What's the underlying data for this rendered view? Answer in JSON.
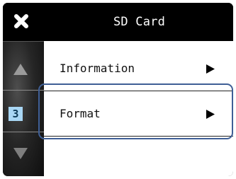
{
  "header": {
    "title": "SD Card",
    "close_icon": "close-icon"
  },
  "side_panel": {
    "page_number": "3",
    "up_icon": "up-arrow-icon",
    "down_icon": "down-arrow-icon"
  },
  "menu": {
    "items": [
      {
        "label": "Information",
        "icon": "right-arrow-icon"
      },
      {
        "label": "Format",
        "icon": "right-arrow-icon",
        "selected": true
      }
    ]
  },
  "colors": {
    "background": "#000000",
    "menu_bg": "#ffffff",
    "page_badge": "#a9d7f5",
    "highlight": "#3f5f96"
  }
}
